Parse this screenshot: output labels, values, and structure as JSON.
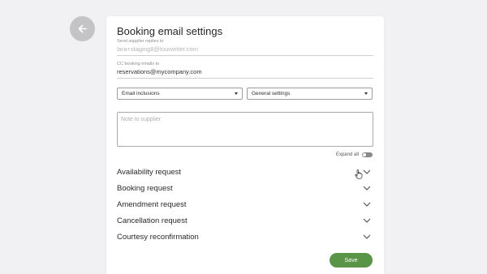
{
  "page": {
    "title": "Booking email settings"
  },
  "fields": {
    "reply_to": {
      "label": "Send supplier replies to",
      "value": "lara+staging8@tourwriter.com"
    },
    "cc": {
      "label": "CC booking emails to",
      "value": "reservations@mycompany.com"
    }
  },
  "selects": {
    "inclusions": "Email inclusions",
    "settings": "General settings"
  },
  "note": {
    "placeholder": "Note to supplier"
  },
  "expand_all": {
    "label": "Expand all",
    "on": false
  },
  "accordions": [
    {
      "label": "Availability request"
    },
    {
      "label": "Booking request"
    },
    {
      "label": "Amendment request"
    },
    {
      "label": "Cancellation request"
    },
    {
      "label": "Courtesy reconfirmation"
    }
  ],
  "buttons": {
    "save": "Save"
  },
  "colors": {
    "accent": "#5a9447",
    "back_button": "#c4c4c6"
  },
  "icons": {
    "back": "arrow-left-icon",
    "chevron": "chevron-down-icon",
    "dropdown": "caret-down-icon"
  }
}
